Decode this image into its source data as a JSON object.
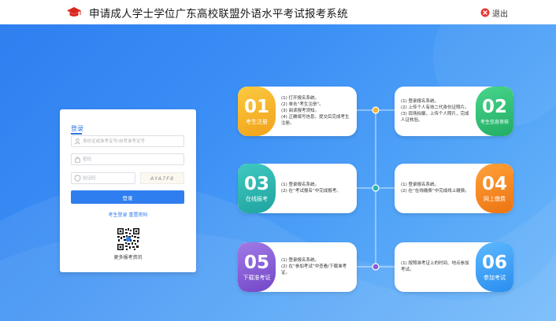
{
  "header": {
    "title": "申请成人学士学位广东高校联盟外语水平考试报考系统",
    "logout_label": "退出"
  },
  "login": {
    "title": "登录",
    "username_placeholder": "身份证或准考证号/自考准考证号",
    "password_placeholder": "密码",
    "captcha_placeholder": "验证码",
    "captcha_text": "AYA7F8",
    "submit_label": "登录",
    "register_link": "考生登录",
    "reset_link": "重置密码",
    "qr_caption": "更多报考资讯"
  },
  "colors": {
    "accent": "#2f7ef0",
    "step1": "#f5b72b",
    "step2": "#33c47a",
    "step3": "#27b5b0",
    "step4": "#f58a1f",
    "step5": "#8a5cd6",
    "step6": "#3fa2f5"
  },
  "flow": [
    {
      "num": "01",
      "label": "考生注册",
      "steps": [
        "(1) 打开报名系统。",
        "(2) 单击“考生注册”。",
        "(3) 阅读报考须知。",
        "(4) 正确填写信息，提交后完成考生注册。"
      ]
    },
    {
      "num": "02",
      "label": "考生信息审核",
      "steps": [
        "(1) 登录报名系统。",
        "(2) 上传个人有效二代身份证照片。",
        "(3) 现场拍摄，上传个人照片，完成人证核验。"
      ]
    },
    {
      "num": "03",
      "label": "在线报考",
      "steps": [
        "(1) 登录报名系统。",
        "(2) 在“考试报名”中完成报考。"
      ]
    },
    {
      "num": "04",
      "label": "网上缴费",
      "steps": [
        "(1) 登录报名系统。",
        "(2) 在“在线缴费”中完成线上缴费。"
      ]
    },
    {
      "num": "05",
      "label": "下载准考证",
      "steps": [
        "(1) 登录报名系统。",
        "(2) 在“参加考试”中查看/下载准考证。"
      ]
    },
    {
      "num": "06",
      "label": "参加考试",
      "steps": [
        "(1) 按照准考证上的时间、地点参加考试。"
      ]
    }
  ]
}
